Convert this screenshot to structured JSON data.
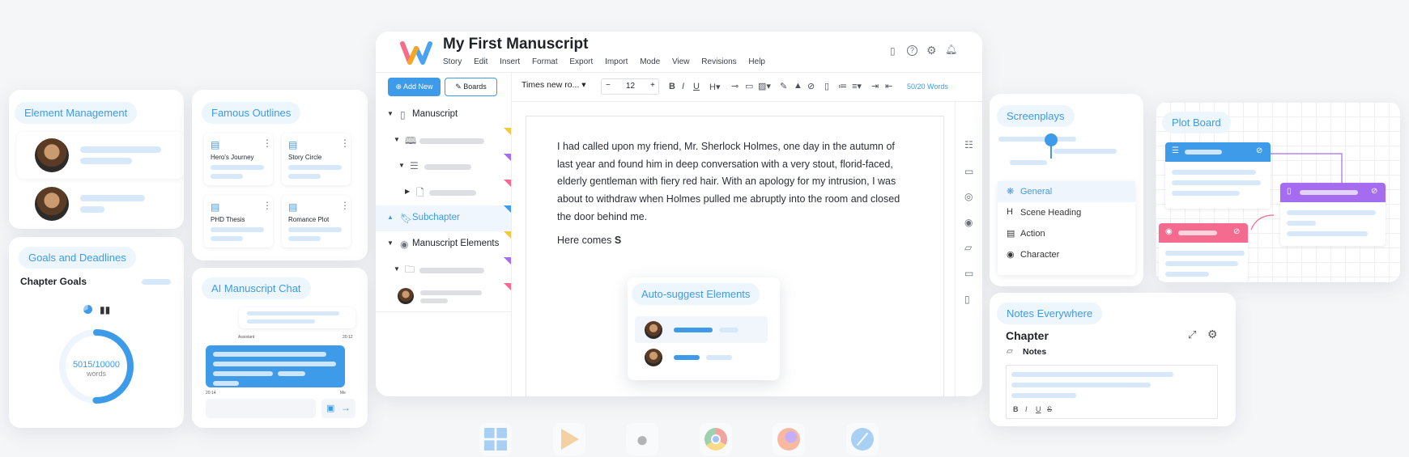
{
  "element_management": {
    "title": "Element Management"
  },
  "famous_outlines": {
    "title": "Famous Outlines",
    "items": [
      "Hero's Journey",
      "Story Circle",
      "PHD Thesis",
      "Romance Plot"
    ]
  },
  "goals": {
    "title": "Goals and Deadlines",
    "subtitle": "Chapter Goals",
    "progress_text": "5015/10000",
    "unit": "words",
    "progress": 0.5015
  },
  "ai_chat": {
    "title": "AI Manuscript Chat",
    "assistant_label": "Assistant",
    "assistant_time": "20:12",
    "user_time": "20:14",
    "user_label": "Me"
  },
  "app": {
    "title": "My First Manuscript",
    "menu": [
      "Story",
      "Edit",
      "Insert",
      "Format",
      "Export",
      "Import",
      "Mode",
      "View",
      "Revisions",
      "Help"
    ],
    "add_new": "Add New",
    "boards": "Boards",
    "font_name": "Times new ro...",
    "font_size": "12",
    "word_count": "50/20 Words",
    "tree": {
      "manuscript": "Manuscript",
      "subchapter": "Subchapter",
      "elements": "Manuscript Elements"
    },
    "paragraph": "I had called upon my friend, Mr. Sherlock Holmes, one day in the autumn of last year and found him in deep conversation with a very stout, florid-faced, elderly gentleman with fiery red hair. With an apology for my intrusion, I was about to withdraw when Holmes pulled me abruptly into the room and closed the door behind me.",
    "here_comes": "Here comes ",
    "here_bold": "S",
    "autosuggest": "Auto-suggest Elements"
  },
  "screenplays": {
    "title": "Screenplays",
    "items": [
      "General",
      "Scene Heading",
      "Action",
      "Character"
    ]
  },
  "plot_board": {
    "title": "Plot Board"
  },
  "notes": {
    "title": "Notes Everywhere",
    "chapter": "Chapter",
    "notes_label": "Notes"
  },
  "colors": {
    "accent": "#3d9be9",
    "purple": "#a56cf0",
    "pink": "#f56b8f",
    "yellow": "#f5c842"
  }
}
